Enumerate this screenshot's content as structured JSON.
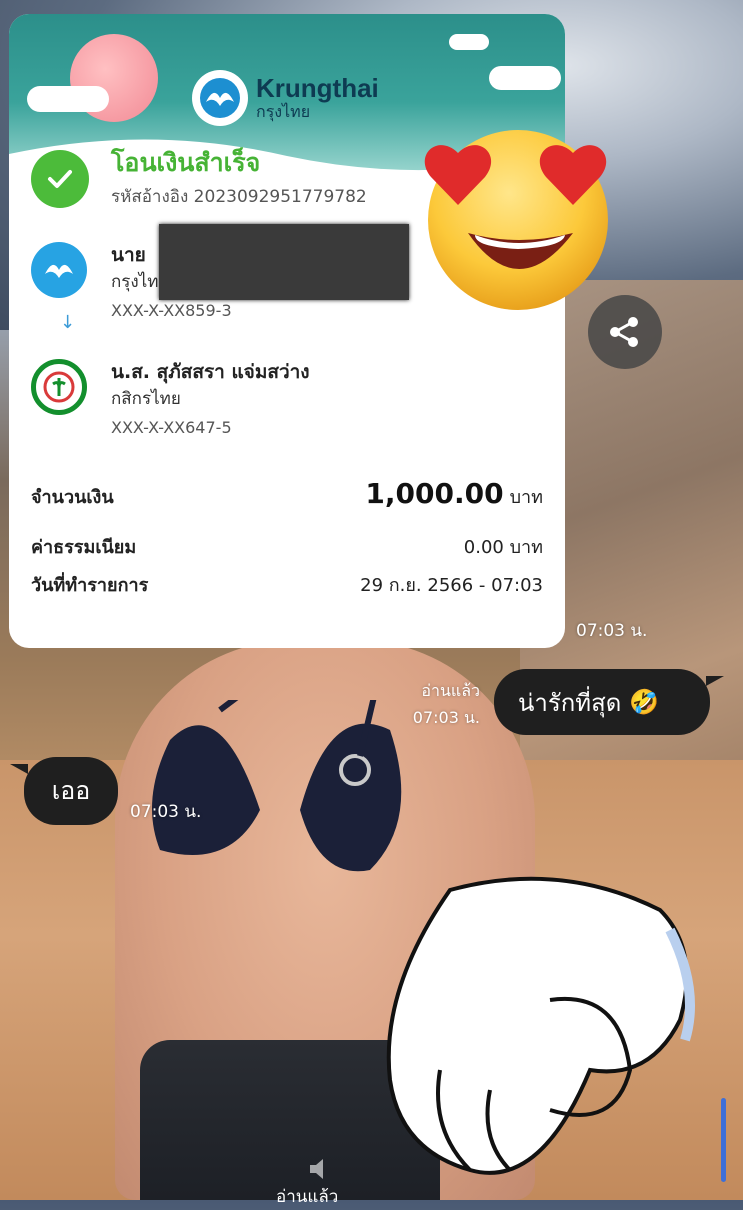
{
  "receipt": {
    "bank_name_en": "Krungthai",
    "bank_name_th": "กรุงไทย",
    "status_title": "โอนเงินสำเร็จ",
    "reference": "รหัสอ้างอิง 2023092951779782",
    "sender": {
      "name": "นาย",
      "bank": "กรุงไทย",
      "account": "XXX-X-XX859-3"
    },
    "receiver": {
      "name": "น.ส. สุภัสสรา แจ่มสว่าง",
      "bank": "กสิกรไทย",
      "account": "XXX-X-XX647-5"
    },
    "amount_label": "จำนวนเงิน",
    "amount_value": "1,000.00",
    "amount_unit": "บาท",
    "fee_label": "ค่าธรรมเนียม",
    "fee_value": "0.00 บาท",
    "date_label": "วันที่ทำรายการ",
    "date_value": "29 ก.ย. 2566 - 07:03"
  },
  "chat": {
    "receipt_time": "07:03 น.",
    "outgoing": {
      "read_label": "อ่านแล้ว",
      "time": "07:03 น.",
      "text": "น่ารักที่สุด",
      "emoji": "🤣"
    },
    "incoming": {
      "text": "เออ",
      "time": "07:03 น."
    },
    "bottom_read_label": "อ่านแล้ว"
  },
  "colors": {
    "success_green": "#4cbb3a",
    "krungthai_teal": "#2c8f8a",
    "bubble_dark": "#1f1f1f",
    "kasikorn_green": "#138f2d"
  },
  "icons": [
    "check-icon",
    "krungthai-logo-icon",
    "kasikorn-logo-icon",
    "share-icon",
    "heart-eyes-emoji",
    "speaker-icon"
  ]
}
